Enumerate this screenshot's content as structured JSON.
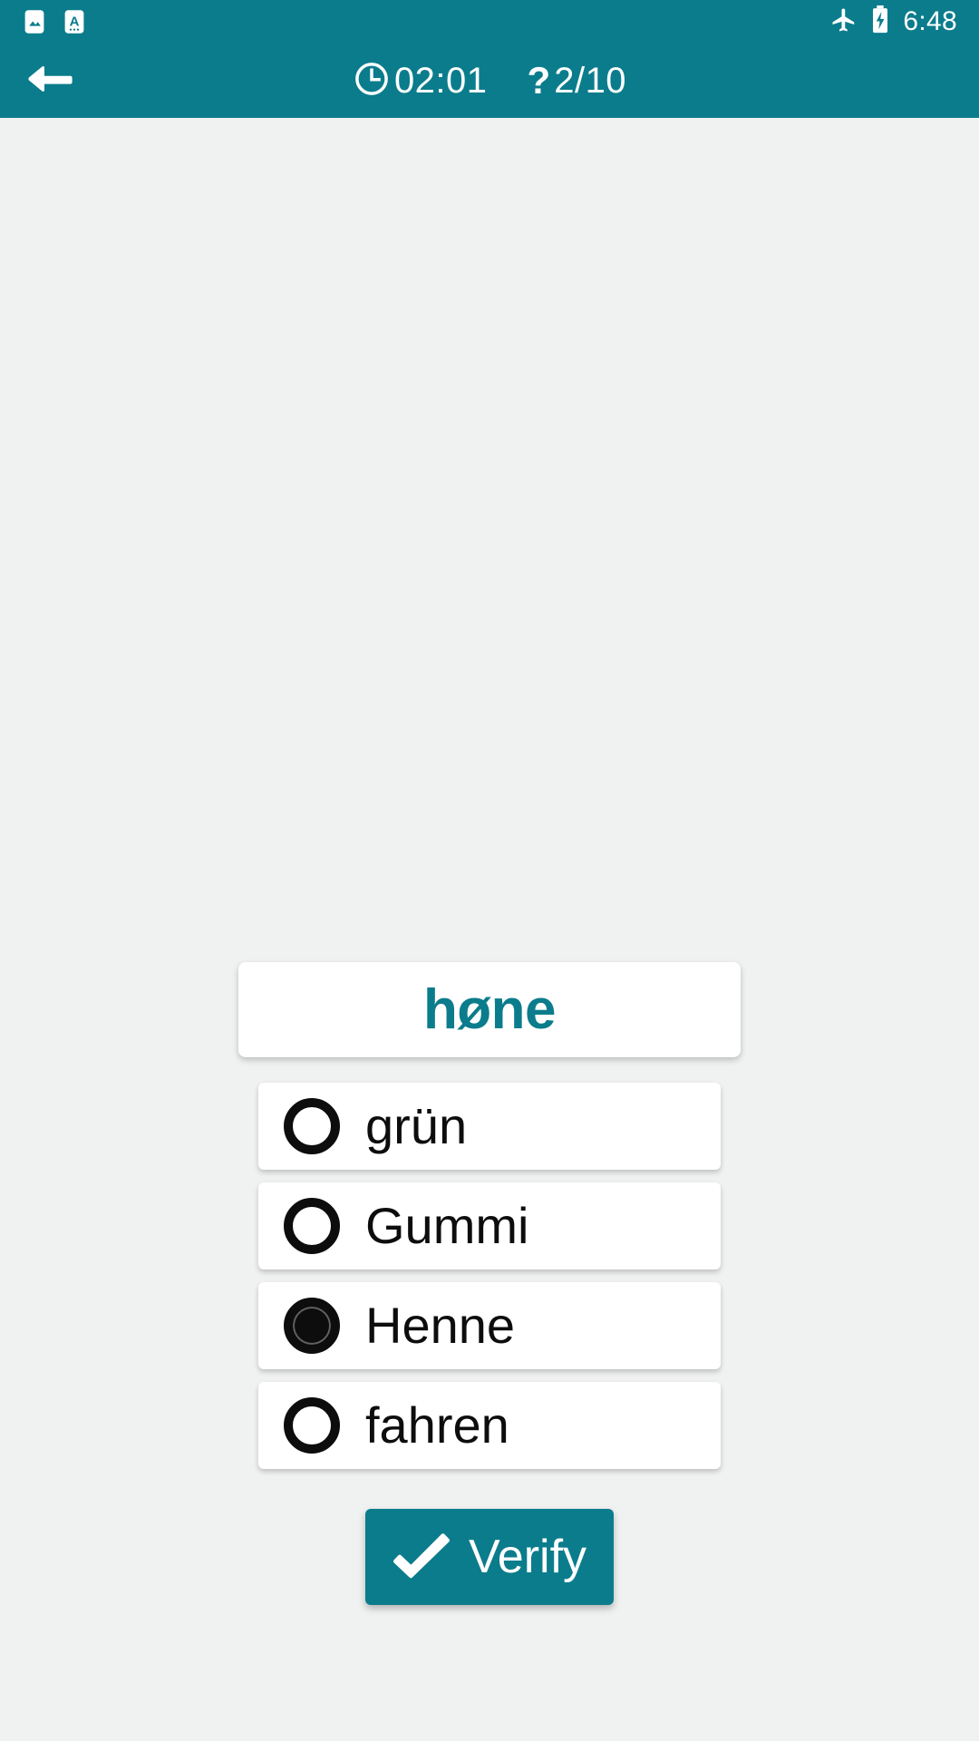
{
  "status_bar": {
    "notifications": [
      {
        "icon": "image-notification-icon"
      },
      {
        "icon": "translate-notification-icon"
      }
    ],
    "airplane_icon": "airplane-mode-icon",
    "battery_icon": "battery-charging-icon",
    "time": "6:48"
  },
  "app_bar": {
    "back_icon": "back-arrow-icon",
    "timer": {
      "icon": "clock-icon",
      "value": "02:01"
    },
    "progress": {
      "icon": "question-mark-icon",
      "value": "2/10"
    }
  },
  "quiz": {
    "question_word": "høne",
    "options": [
      {
        "label": "grün",
        "selected": false
      },
      {
        "label": "Gummi",
        "selected": false
      },
      {
        "label": "Henne",
        "selected": true
      },
      {
        "label": "fahren",
        "selected": false
      }
    ],
    "verify_button": {
      "label": "Verify",
      "icon": "check-icon"
    }
  },
  "colors": {
    "accent": "#0b7c8c",
    "background": "#f0f1f1",
    "card": "#ffffff",
    "text": "#0d0d0d",
    "on_accent": "#ffffff"
  }
}
